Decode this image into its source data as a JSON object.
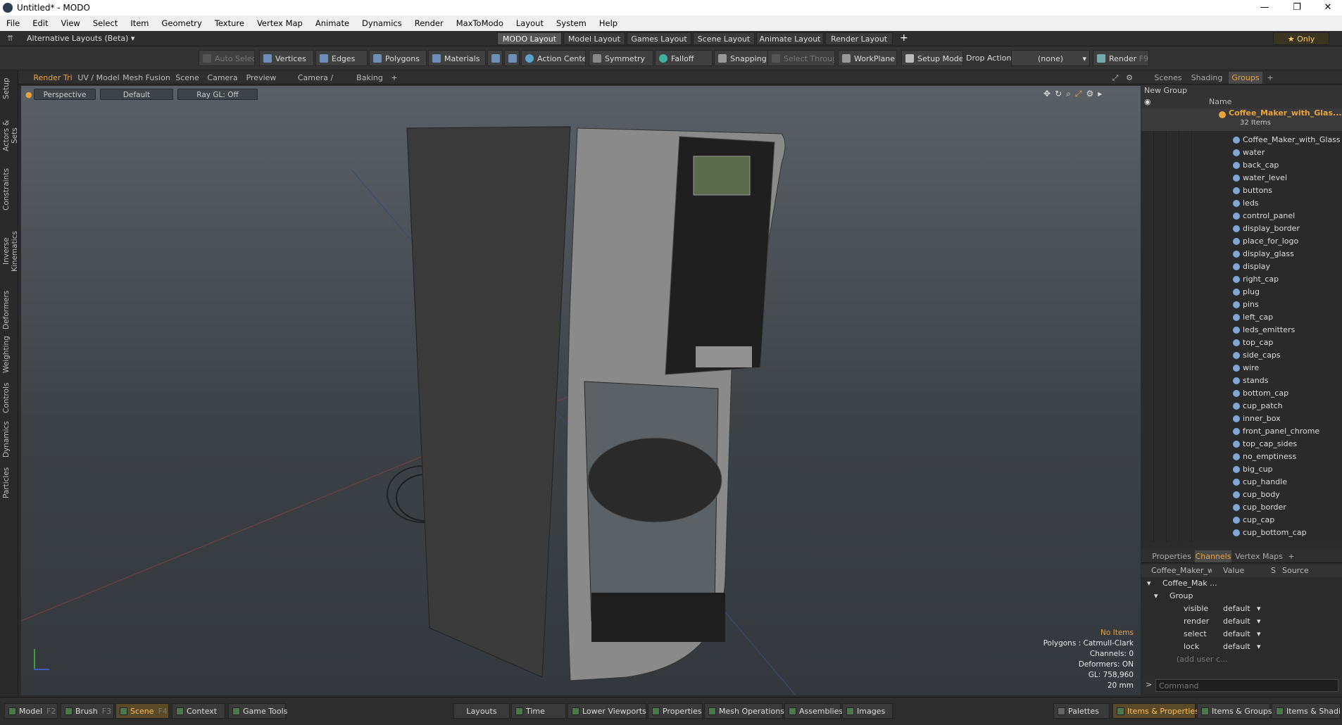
{
  "window": {
    "title": "Untitled* - MODO",
    "minimize": "—",
    "restore": "❐",
    "close": "✕"
  },
  "menu": [
    "File",
    "Edit",
    "View",
    "Select",
    "Item",
    "Geometry",
    "Texture",
    "Vertex Map",
    "Animate",
    "Dynamics",
    "Render",
    "MaxToModo",
    "Layout",
    "System",
    "Help"
  ],
  "layout_bar": {
    "selector": "Alternative Layouts (Beta) ▾",
    "tabs": [
      "MODO Layout",
      "Model Layout",
      "Games Layout",
      "Scene Layout",
      "Animate Layout",
      "Render Layout"
    ],
    "active_tab": "MODO Layout",
    "add": "+",
    "only": "★ Only"
  },
  "toolbar": {
    "auto_select": "Auto Select",
    "vertices": "Vertices",
    "edges": "Edges",
    "polygons": "Polygons",
    "materials": "Materials",
    "action_center": "Action Center",
    "symmetry": "Symmetry",
    "falloff": "Falloff",
    "snapping": "Snapping",
    "select_through": "Select Through",
    "workplane": "WorkPlane",
    "setup_mode": "Setup Mode",
    "drop_action_label": "Drop Action",
    "drop_action_value": "(none)",
    "render": "Render",
    "render_key": "F9"
  },
  "left_tabs": [
    "Setup",
    "Actors & Sets",
    "Constraints",
    "Inverse Kinematics",
    "Deformers",
    "Weighting",
    "Controls",
    "Dynamics",
    "Particles"
  ],
  "viewport_tabs": [
    "Render Tri",
    "UV / Model",
    "Mesh Fusion",
    "Scene",
    "Camera",
    "Preview",
    "Camera / Preview",
    "Baking"
  ],
  "viewport_tabs_add": "+",
  "viewport": {
    "view": "Perspective",
    "shading": "Default",
    "raygl": "Ray GL: Off"
  },
  "viewport_info": {
    "status": "No Items",
    "polygons": "Polygons : Catmull-Clark",
    "channels": "Channels: 0",
    "deformers": "Deformers: ON",
    "gl": "GL: 758,960",
    "scale": "20 mm"
  },
  "right_tabs": [
    "Scenes",
    "Shading",
    "Groups"
  ],
  "right_tabs_add": "+",
  "groups": {
    "new_group": "New Group",
    "header_name": "Name",
    "root_name": "Coffee_Maker_with_Glas...",
    "root_count": "32 Items",
    "items": [
      "Coffee_Maker_with_Glass_...",
      "water",
      "back_cap",
      "water_level",
      "buttons",
      "leds",
      "control_panel",
      "display_border",
      "place_for_logo",
      "display_glass",
      "display",
      "right_cap",
      "plug",
      "pins",
      "left_cap",
      "leds_emitters",
      "top_cap",
      "side_caps",
      "wire",
      "stands",
      "bottom_cap",
      "cup_patch",
      "inner_box",
      "front_panel_chrome",
      "top_cap_sides",
      "no_emptiness",
      "big_cup",
      "cup_handle",
      "cup_body",
      "cup_border",
      "cup_cap",
      "cup_bottom_cap"
    ]
  },
  "channel_tabs": [
    "Properties",
    "Channels",
    "Vertex Maps"
  ],
  "channel_tabs_add": "+",
  "channels": {
    "col_name": "Coffee_Maker_wi...",
    "col_value": "Value",
    "col_s": "S",
    "col_source": "Source",
    "tree1": "Coffee_Mak ...",
    "tree2": "Group",
    "rows": [
      {
        "name": "visible",
        "value": "default"
      },
      {
        "name": "render",
        "value": "default"
      },
      {
        "name": "select",
        "value": "default"
      },
      {
        "name": "lock",
        "value": "default"
      }
    ],
    "add_user": "(add user c..."
  },
  "command": {
    "placeholder": "Command",
    "prompt": ">"
  },
  "bottom_bar": {
    "left": [
      {
        "label": "Model",
        "key": "F2"
      },
      {
        "label": "Brush",
        "key": "F3"
      },
      {
        "label": "Scene",
        "key": "F4"
      },
      {
        "label": "Context",
        "key": ""
      },
      {
        "label": "Game Tools",
        "key": ""
      }
    ],
    "middle": [
      "Layouts",
      "Time",
      "Lower Viewports",
      "Properties",
      "Mesh Operations",
      "Assemblies",
      "Images"
    ],
    "right": [
      "Palettes",
      "Items & Properties",
      "Items & Groups",
      "Items & Shading"
    ]
  },
  "colors": {
    "accent": "#e8a43a",
    "viewport_top": "#5a6066",
    "viewport_bottom": "#34383c"
  }
}
